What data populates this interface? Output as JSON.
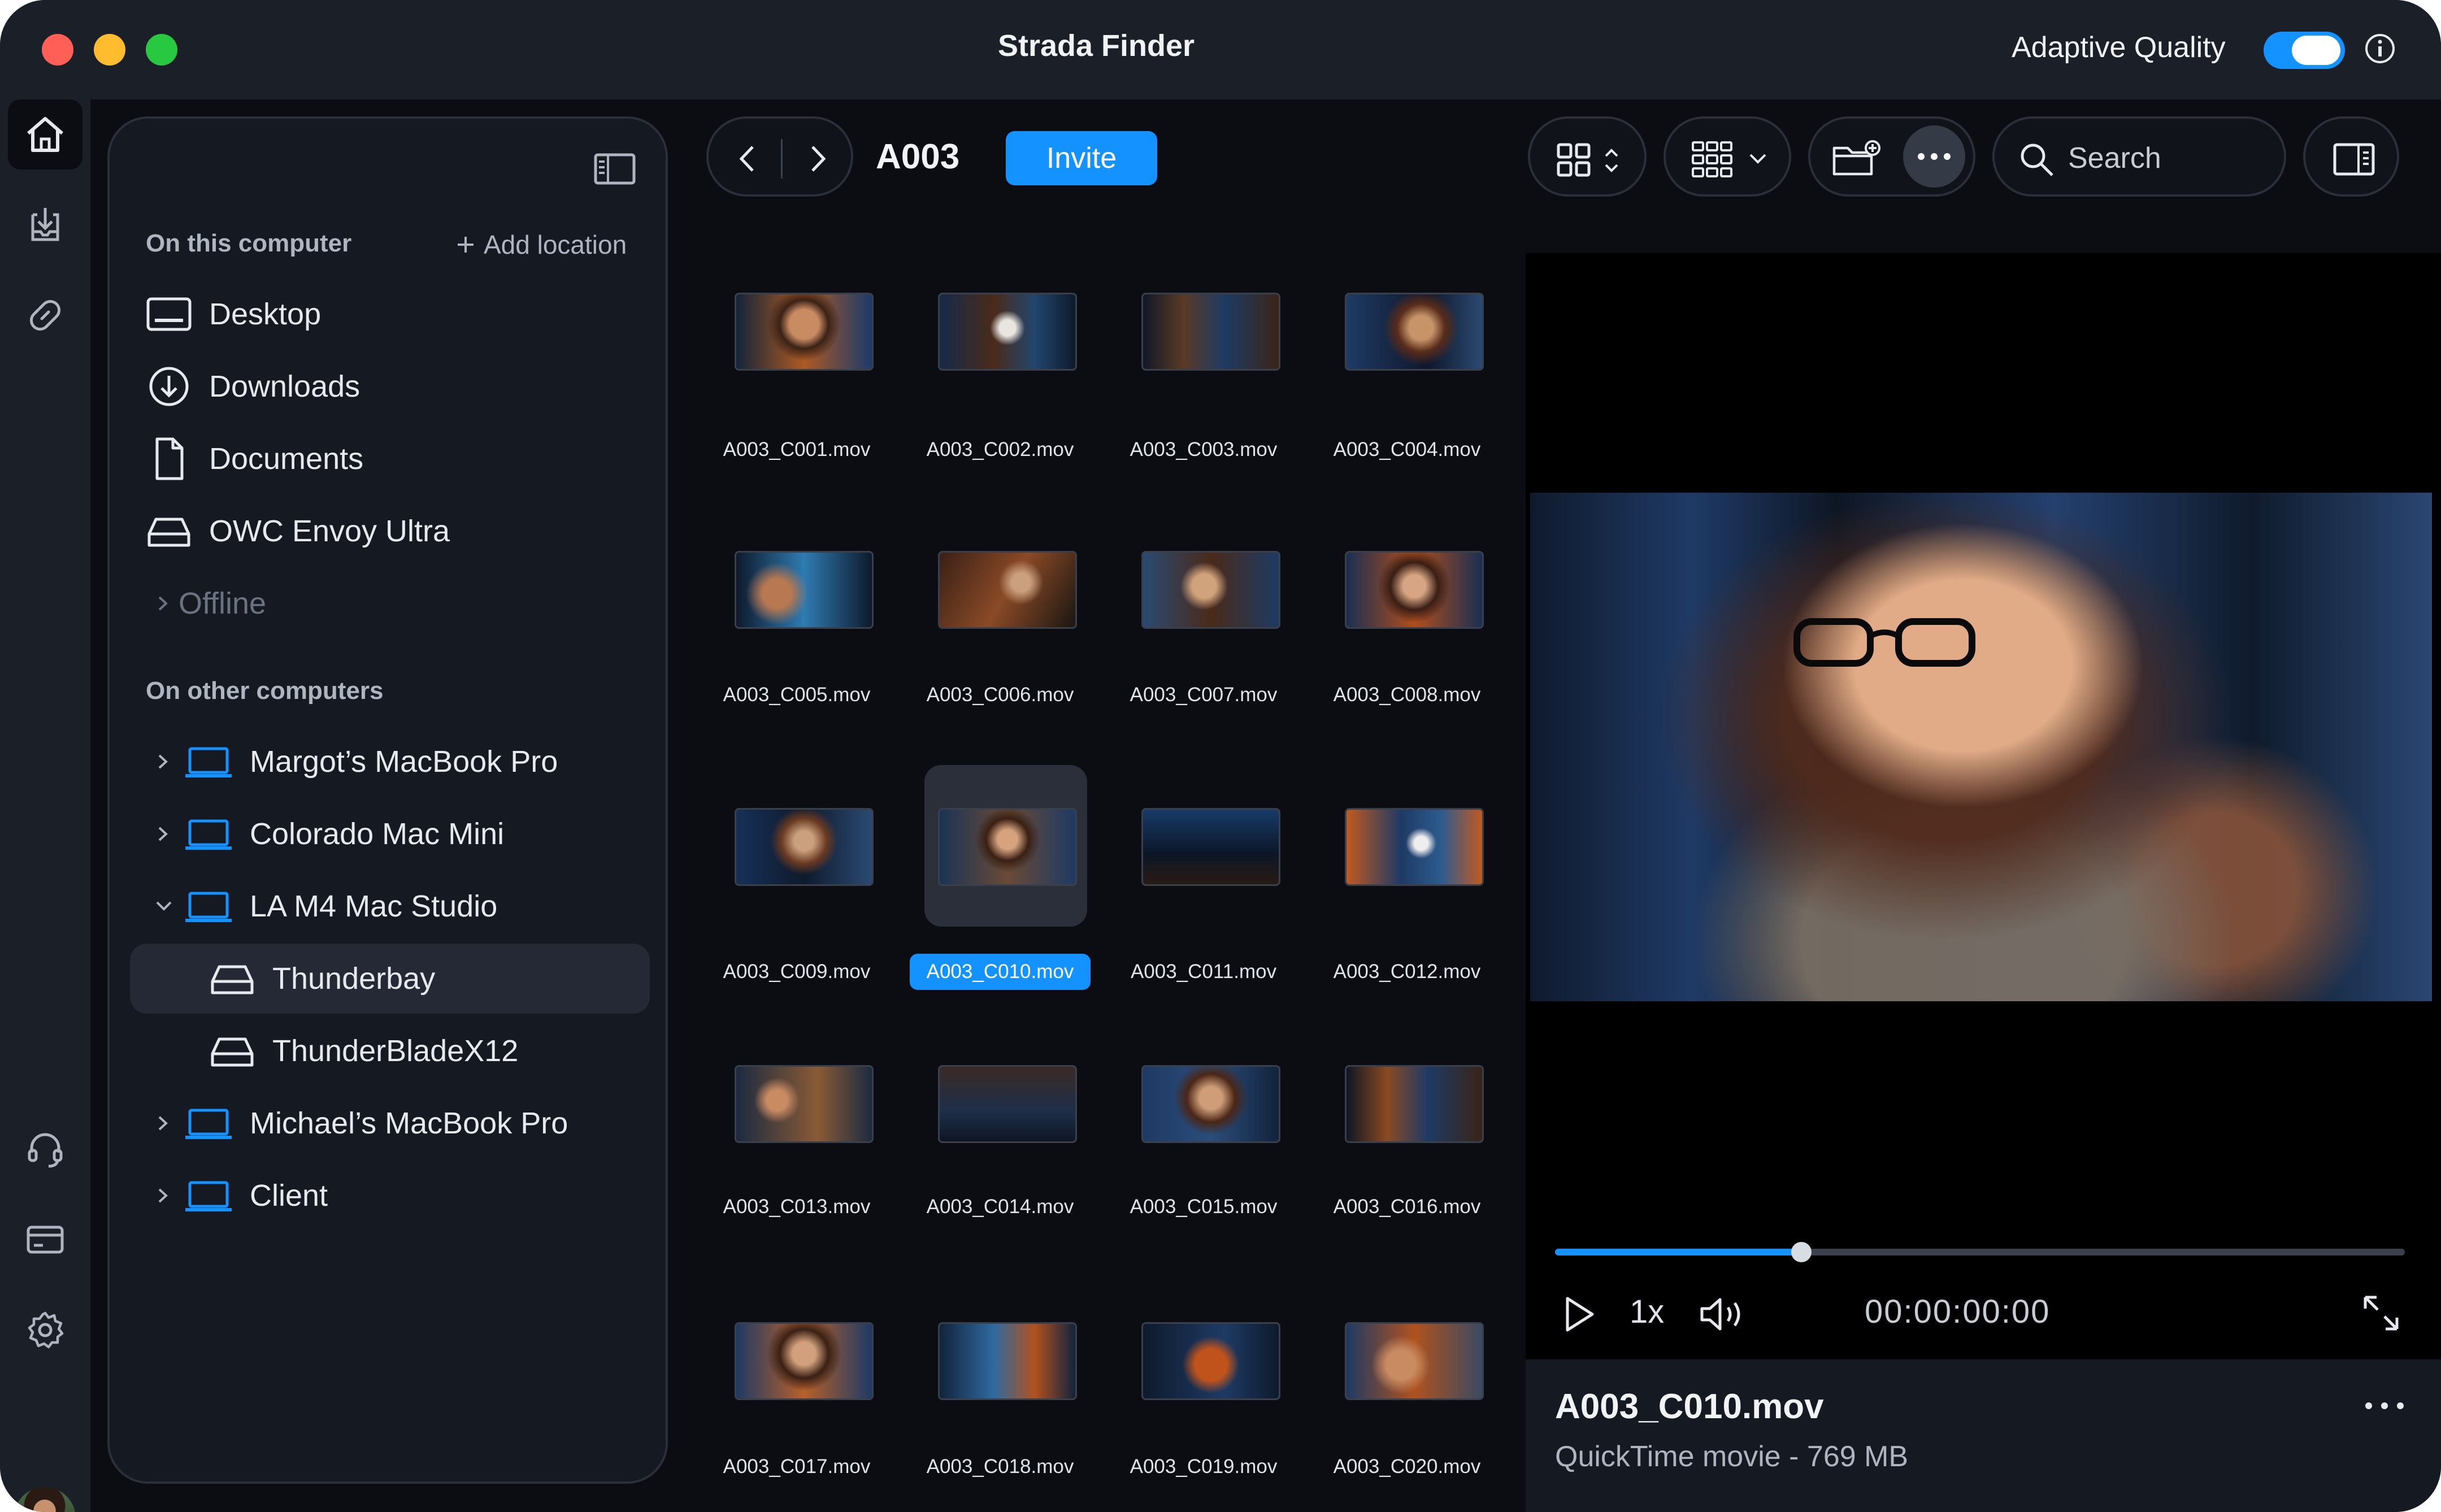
{
  "window": {
    "title": "Strada Finder",
    "adaptive_quality_label": "Adaptive Quality",
    "adaptive_quality_on": true
  },
  "sidebar": {
    "section_local": "On this computer",
    "add_location": "Add location",
    "local_items": [
      {
        "label": "Desktop",
        "icon": "desktop-icon"
      },
      {
        "label": "Downloads",
        "icon": "download-icon"
      },
      {
        "label": "Documents",
        "icon": "document-icon"
      },
      {
        "label": "OWC Envoy Ultra",
        "icon": "drive-icon"
      },
      {
        "label": "Offline",
        "icon": "chevron-right-icon"
      }
    ],
    "section_other": "On other computers",
    "other_items": [
      {
        "label": "Margot’s MacBook Pro",
        "icon": "laptop-icon"
      },
      {
        "label": "Colorado Mac Mini",
        "icon": "laptop-icon"
      },
      {
        "label": "LA M4 Mac Studio",
        "icon": "laptop-icon"
      },
      {
        "label": "Thunderbay",
        "icon": "drive-icon"
      },
      {
        "label": "ThunderBladeX12",
        "icon": "drive-icon"
      },
      {
        "label": "Michael’s MacBook Pro",
        "icon": "laptop-icon"
      },
      {
        "label": "Client",
        "icon": "laptop-icon"
      }
    ]
  },
  "browser": {
    "folder": "A003",
    "invite_label": "Invite",
    "search_placeholder": "Search",
    "files": [
      "A003_C001.mov",
      "A003_C002.mov",
      "A003_C003.mov",
      "A003_C004.mov",
      "A003_C005.mov",
      "A003_C006.mov",
      "A003_C007.mov",
      "A003_C008.mov",
      "A003_C009.mov",
      "A003_C010.mov",
      "A003_C011.mov",
      "A003_C012.mov",
      "A003_C013.mov",
      "A003_C014.mov",
      "A003_C015.mov",
      "A003_C016.mov",
      "A003_C017.mov",
      "A003_C018.mov",
      "A003_C019.mov",
      "A003_C020.mov"
    ],
    "selected_file": "A003_C010.mov"
  },
  "preview": {
    "playback_rate": "1x",
    "timecode": "00:00:00:00",
    "progress": 0.29,
    "file_name": "A003_C010.mov",
    "file_meta": "QuickTime movie - 769 MB"
  },
  "colors": {
    "accent": "#1492ff",
    "window_bg": "#0b0d12",
    "panel_bg": "#151922"
  }
}
